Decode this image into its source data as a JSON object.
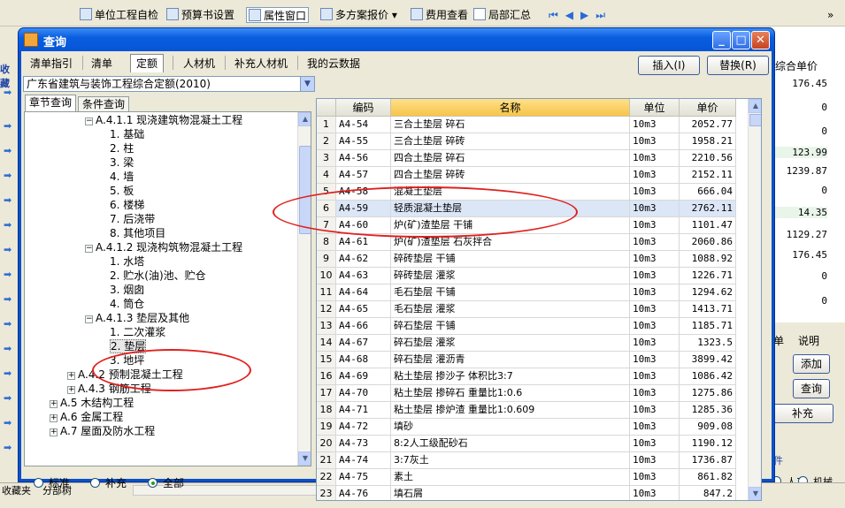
{
  "toolbar": {
    "items": [
      "单位工程自检",
      "预算书设置",
      "属性窗口",
      "多方案报价",
      "费用查看",
      "局部汇总"
    ],
    "overflow": "»"
  },
  "background": {
    "left_label": "收藏",
    "right_header": "综合单价",
    "right_values": [
      "176.45",
      "0",
      "0",
      "123.99",
      "1239.87",
      "0",
      "14.35",
      "1129.27",
      "176.45",
      "0",
      "0"
    ],
    "right_tab_labels": [
      "单",
      "说明"
    ],
    "right_buttons": [
      "添加",
      "查询",
      "补充"
    ],
    "right_group_label": "件",
    "right_radios": [
      "人工",
      "机械"
    ],
    "bottom_tabs": [
      "收藏夹",
      "分部树"
    ]
  },
  "dialog": {
    "title": "查询",
    "tabs": [
      "清单指引",
      "清单",
      "定额",
      "人材机",
      "补充人材机",
      "我的云数据"
    ],
    "active_tab": "定额",
    "insert_button": "插入(I)",
    "replace_button": "替换(R)",
    "norm_combo": "广东省建筑与装饰工程综合定额(2010)",
    "search_tabs": [
      "章节查询",
      "条件查询"
    ],
    "tree": [
      {
        "level": 3,
        "exp": "−",
        "text": "A.4.1.1 现浇建筑物混凝土工程"
      },
      {
        "level": 4,
        "exp": "",
        "text": "1. 基础"
      },
      {
        "level": 4,
        "exp": "",
        "text": "2. 柱"
      },
      {
        "level": 4,
        "exp": "",
        "text": "3. 梁"
      },
      {
        "level": 4,
        "exp": "",
        "text": "4. 墙"
      },
      {
        "level": 4,
        "exp": "",
        "text": "5. 板"
      },
      {
        "level": 4,
        "exp": "",
        "text": "6. 楼梯"
      },
      {
        "level": 4,
        "exp": "",
        "text": "7. 后浇带"
      },
      {
        "level": 4,
        "exp": "",
        "text": "8. 其他项目"
      },
      {
        "level": 3,
        "exp": "−",
        "text": "A.4.1.2 现浇构筑物混凝土工程"
      },
      {
        "level": 4,
        "exp": "",
        "text": "1. 水塔"
      },
      {
        "level": 4,
        "exp": "",
        "text": "2. 贮水(油)池、贮仓"
      },
      {
        "level": 4,
        "exp": "",
        "text": "3. 烟囱"
      },
      {
        "level": 4,
        "exp": "",
        "text": "4. 筒仓"
      },
      {
        "level": 3,
        "exp": "−",
        "text": "A.4.1.3 垫层及其他"
      },
      {
        "level": 4,
        "exp": "",
        "text": "1. 二次灌浆"
      },
      {
        "level": 4,
        "exp": "",
        "text": "2. 垫层",
        "selected": true
      },
      {
        "level": 4,
        "exp": "",
        "text": "3. 地坪"
      },
      {
        "level": 2,
        "exp": "+",
        "text": "A.4.2 预制混凝土工程"
      },
      {
        "level": 2,
        "exp": "+",
        "text": "A.4.3 钢筋工程"
      },
      {
        "level": 1,
        "exp": "+",
        "text": "A.5 木结构工程"
      },
      {
        "level": 1,
        "exp": "+",
        "text": "A.6 金属工程"
      },
      {
        "level": 1,
        "exp": "+",
        "text": "A.7 屋面及防水工程"
      }
    ],
    "filter_radios": [
      "标准",
      "补充",
      "全部"
    ],
    "filter_selected": "全部",
    "grid_headers": [
      "编码",
      "名称",
      "单位",
      "单价"
    ],
    "rows": [
      [
        "1",
        "A4-54",
        "三合土垫层 碎石",
        "10m3",
        "2052.77"
      ],
      [
        "2",
        "A4-55",
        "三合土垫层 碎砖",
        "10m3",
        "1958.21"
      ],
      [
        "3",
        "A4-56",
        "四合土垫层 碎石",
        "10m3",
        "2210.56"
      ],
      [
        "4",
        "A4-57",
        "四合土垫层 碎砖",
        "10m3",
        "2152.11"
      ],
      [
        "5",
        "A4-58",
        "混凝土垫层",
        "10m3",
        "666.04"
      ],
      [
        "6",
        "A4-59",
        "轻质混凝土垫层",
        "10m3",
        "2762.11"
      ],
      [
        "7",
        "A4-60",
        "炉(矿)渣垫层 干铺",
        "10m3",
        "1101.47"
      ],
      [
        "8",
        "A4-61",
        "炉(矿)渣垫层 石灰拌合",
        "10m3",
        "2060.86"
      ],
      [
        "9",
        "A4-62",
        "碎砖垫层 干铺",
        "10m3",
        "1088.92"
      ],
      [
        "10",
        "A4-63",
        "碎砖垫层 灌浆",
        "10m3",
        "1226.71"
      ],
      [
        "11",
        "A4-64",
        "毛石垫层 干铺",
        "10m3",
        "1294.62"
      ],
      [
        "12",
        "A4-65",
        "毛石垫层 灌浆",
        "10m3",
        "1413.71"
      ],
      [
        "13",
        "A4-66",
        "碎石垫层 干铺",
        "10m3",
        "1185.71"
      ],
      [
        "14",
        "A4-67",
        "碎石垫层 灌浆",
        "10m3",
        "1323.5"
      ],
      [
        "15",
        "A4-68",
        "碎石垫层 灌沥青",
        "10m3",
        "3899.42"
      ],
      [
        "16",
        "A4-69",
        "粘土垫层 掺沙子 体积比3:7",
        "10m3",
        "1086.42"
      ],
      [
        "17",
        "A4-70",
        "粘土垫层 掺碎石 重量比1:0.6",
        "10m3",
        "1275.86"
      ],
      [
        "18",
        "A4-71",
        "粘土垫层 掺炉渣 重量比1:0.609",
        "10m3",
        "1285.36"
      ],
      [
        "19",
        "A4-72",
        "填砂",
        "10m3",
        "909.08"
      ],
      [
        "20",
        "A4-73",
        "8:2人工级配砂石",
        "10m3",
        "1190.12"
      ],
      [
        "21",
        "A4-74",
        "3:7灰土",
        "10m3",
        "1736.87"
      ],
      [
        "22",
        "A4-75",
        "素土",
        "10m3",
        "861.82"
      ],
      [
        "23",
        "A4-76",
        "填石屑",
        "10m3",
        "847.2"
      ]
    ],
    "selected_row": 6
  },
  "colors": {
    "title_blue": "#0a5ee0",
    "selection": "#dbe6f6",
    "highlight_header": "#f7c548",
    "annotation_red": "#e0201e"
  }
}
